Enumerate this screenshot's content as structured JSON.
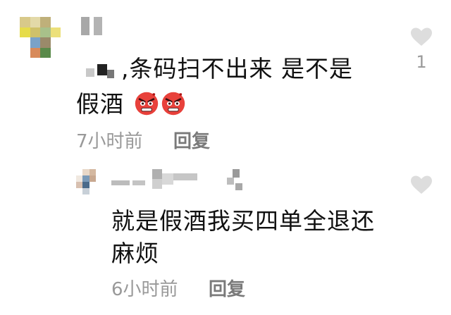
{
  "comments": [
    {
      "text_prefix": ",条码扫不出来 是不是",
      "text_line2": "假酒",
      "emoji": "angry-face-emoji",
      "time": "7小时前",
      "reply_label": "回复",
      "likes": "1"
    }
  ],
  "reply": {
    "text_line1": "就是假酒我买四单全退还",
    "text_line2": "麻烦",
    "time": "6小时前",
    "reply_label": "回复"
  },
  "colors": {
    "muted_text": "#999999",
    "reply_link": "#7a7a7a",
    "heart": "#dddddd",
    "emoji_red": "#e8413b"
  }
}
